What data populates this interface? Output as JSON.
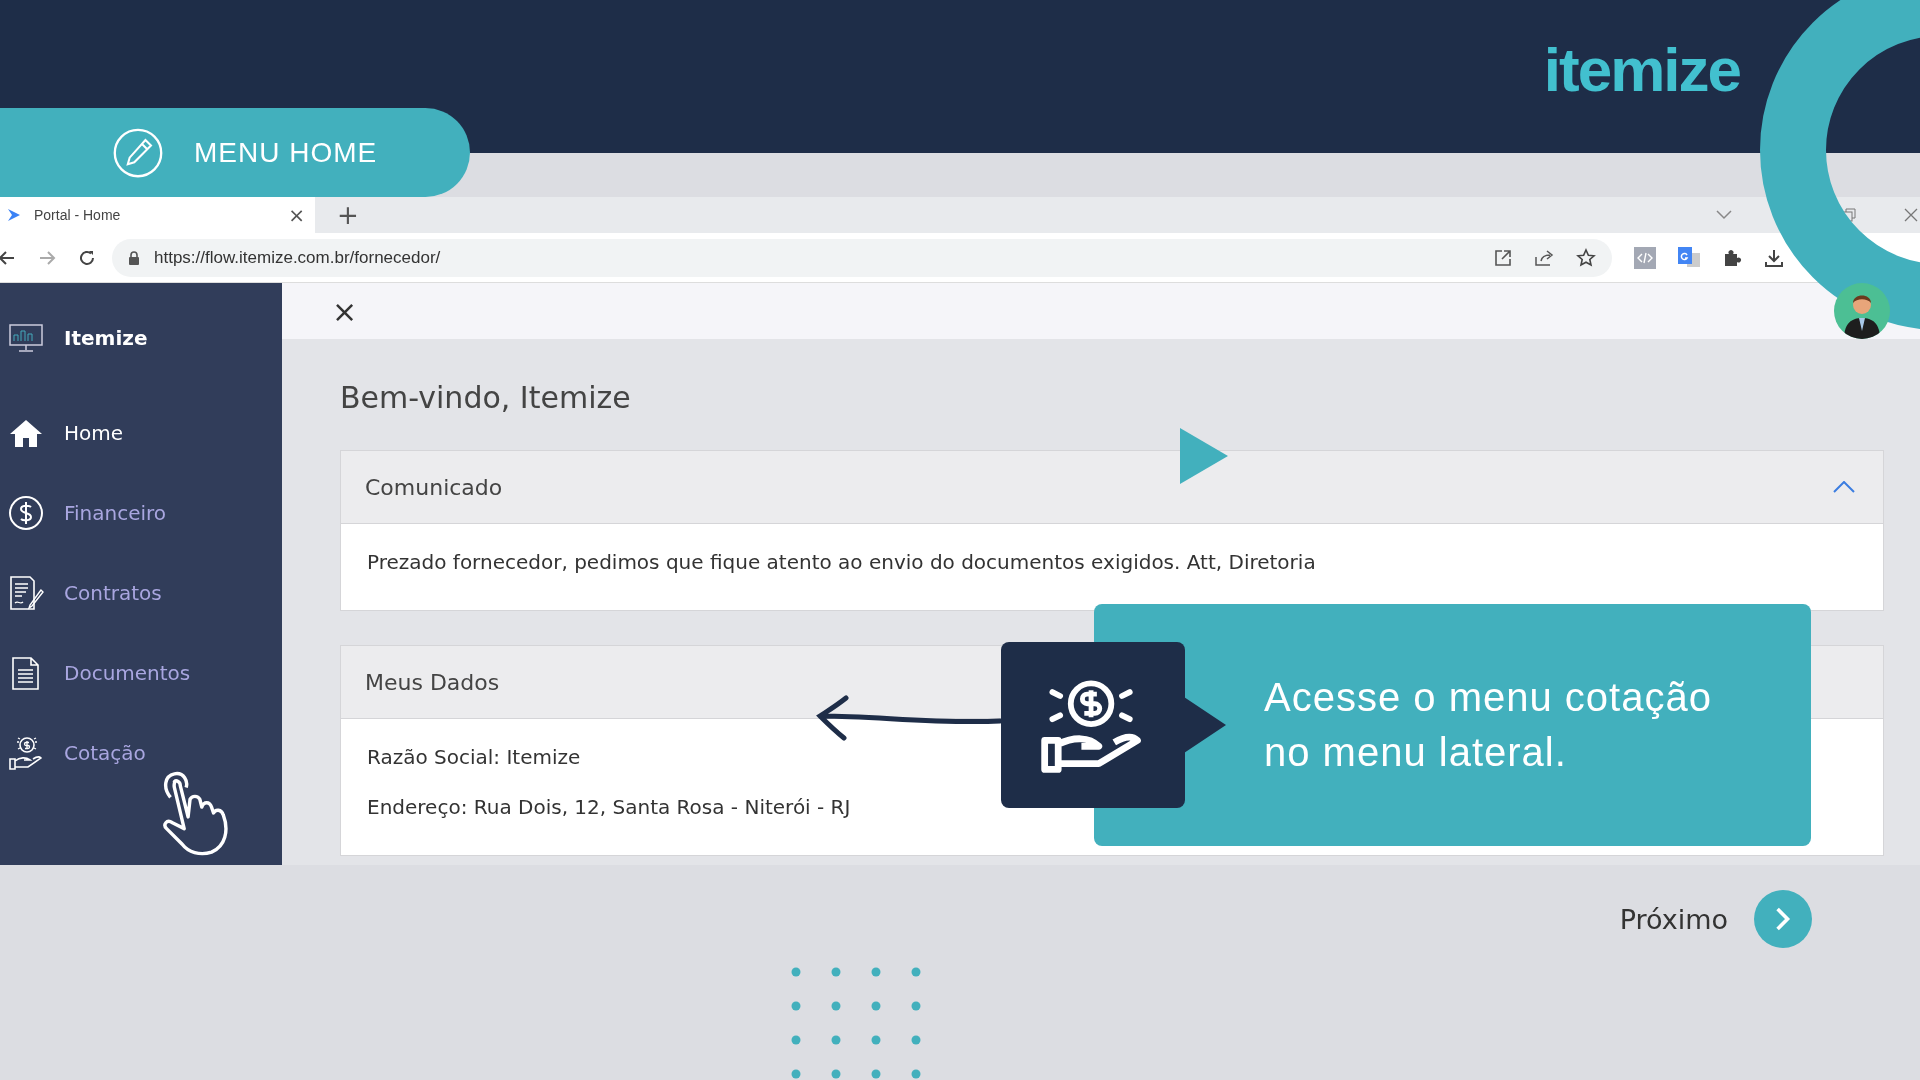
{
  "logo": "itemize",
  "banner": {
    "label": "MENU HOME"
  },
  "browser": {
    "tab": {
      "title": "Portal - Home",
      "close": "×"
    },
    "new_tab": "+",
    "url": "https://flow.itemize.com.br/fornecedor/"
  },
  "sidebar": {
    "brand": "Itemize",
    "items": [
      {
        "label": "Home",
        "selected": true
      },
      {
        "label": "Financeiro",
        "selected": false
      },
      {
        "label": "Contratos",
        "selected": false
      },
      {
        "label": "Documentos",
        "selected": false
      },
      {
        "label": "Cotação",
        "selected": false
      }
    ]
  },
  "header": {
    "close": "×"
  },
  "welcome": "Bem-vindo, Itemize",
  "cards": [
    {
      "title": "Comunicado",
      "expanded": true,
      "lines": [
        "Prezado fornecedor, pedimos que fique atento ao envio do documentos exigidos. Att, Diretoria"
      ]
    },
    {
      "title": "Meus Dados",
      "lines": [
        "Razão Social: Itemize",
        "Endereço: Rua Dois, 12, Santa Rosa - Niterói - RJ"
      ]
    }
  ],
  "callout": {
    "text": "Acesse o menu cotação no menu lateral."
  },
  "next": {
    "label": "Próximo"
  }
}
